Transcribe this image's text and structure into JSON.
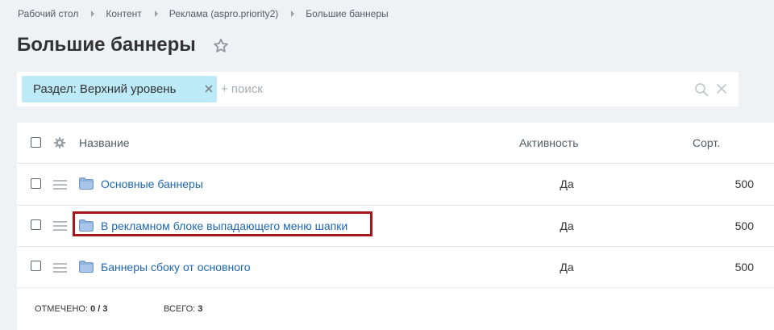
{
  "breadcrumb": {
    "items": [
      "Рабочий стол",
      "Контент",
      "Реклама (aspro.priority2)",
      "Большие баннеры"
    ]
  },
  "page": {
    "title": "Большие баннеры"
  },
  "filter": {
    "chip_label": "Раздел: Верхний уровень",
    "search_placeholder": "+ поиск"
  },
  "grid": {
    "columns": {
      "name": "Название",
      "activity": "Активность",
      "sort": "Сорт."
    },
    "rows": [
      {
        "name": "Основные баннеры",
        "activity": "Да",
        "sort": "500"
      },
      {
        "name": "В рекламном блоке выпадающего меню шапки",
        "activity": "Да",
        "sort": "500"
      },
      {
        "name": "Баннеры сбоку от основного",
        "activity": "Да",
        "sort": "500"
      }
    ],
    "footer": {
      "selected_label": "Отмечено:",
      "selected_value": "0 / 3",
      "total_label": "Всего:",
      "total_value": "3"
    }
  },
  "colors": {
    "background": "#eef2f4",
    "link": "#2067b0",
    "chip": "#bceaf7",
    "highlight": "#a7161c"
  }
}
